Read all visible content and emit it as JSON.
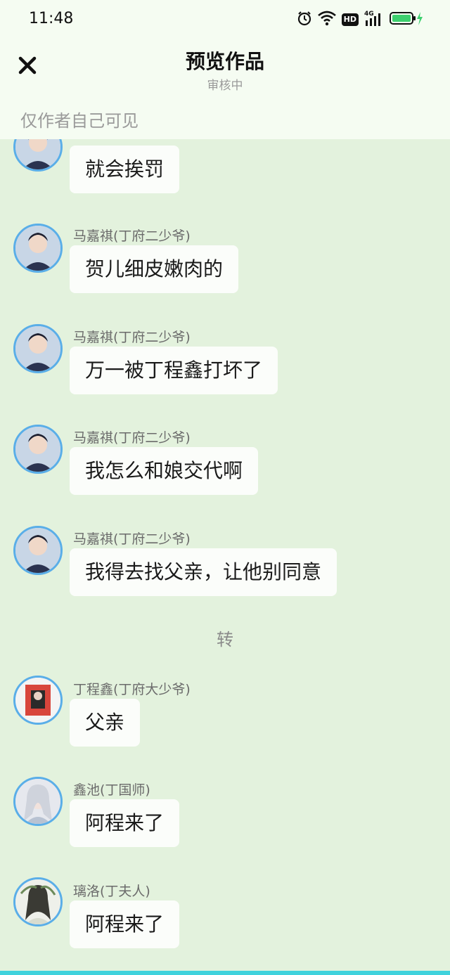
{
  "status_bar": {
    "time": "11:48",
    "network_label": "4G",
    "hd_label": "HD"
  },
  "header": {
    "title": "预览作品",
    "subtitle": "审核中",
    "visibility_note": "仅作者自己可见"
  },
  "messages": [
    {
      "sender": "",
      "text": "就会挨罚"
    },
    {
      "sender": "马嘉祺(丁府二少爷)",
      "text": "贺儿细皮嫩肉的"
    },
    {
      "sender": "马嘉祺(丁府二少爷)",
      "text": "万一被丁程鑫打坏了"
    },
    {
      "sender": "马嘉祺(丁府二少爷)",
      "text": "我怎么和娘交代啊"
    },
    {
      "sender": "马嘉祺(丁府二少爷)",
      "text": "我得去找父亲，让他别同意"
    },
    {
      "sender": "丁程鑫(丁府大少爷)",
      "text": "父亲"
    },
    {
      "sender": "鑫池(丁国师)",
      "text": "阿程来了"
    },
    {
      "sender": "璃洛(丁夫人)",
      "text": "阿程来了"
    }
  ],
  "scene_break": "转",
  "colors": {
    "chat_background": "#e3f2dd",
    "header_background": "#f5fcf2",
    "bubble": "#fbfdfa",
    "avatar_ring": "#5aaee8",
    "battery": "#3ccf6e"
  }
}
